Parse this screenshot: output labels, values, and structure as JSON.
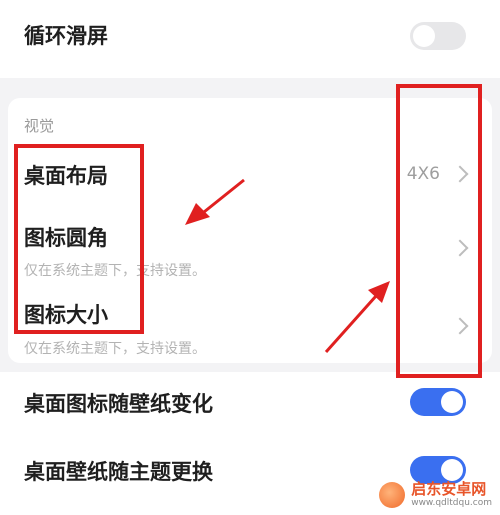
{
  "loop_scroll": {
    "label": "循环滑屏",
    "toggle_state": "off"
  },
  "visual": {
    "section_label": "视觉",
    "desktop_layout": {
      "label": "桌面布局",
      "value": "4X6"
    },
    "icon_corner": {
      "label": "图标圆角",
      "hint": "仅在系统主题下，支持设置。"
    },
    "icon_size": {
      "label": "图标大小",
      "hint": "仅在系统主题下，支持设置。"
    }
  },
  "icon_follow_wallpaper": {
    "label": "桌面图标随壁纸变化",
    "toggle_state": "on"
  },
  "wallpaper_follow_theme": {
    "label": "桌面壁纸随主题更换",
    "toggle_state": "on"
  },
  "annotation_color": "#e02020",
  "accent_color": "#3a6ff0",
  "watermark": {
    "name": "启东安卓网",
    "url": "www.qdltdqu.com"
  }
}
